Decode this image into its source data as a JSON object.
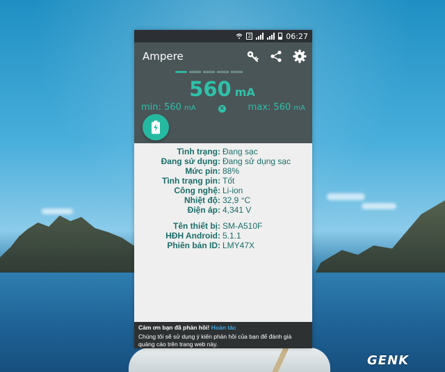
{
  "status_bar": {
    "sim_label": "2",
    "time": "06:27"
  },
  "app": {
    "title": "Ampere",
    "icons": [
      "key-icon",
      "share-icon",
      "settings-gear-icon"
    ]
  },
  "pager": {
    "count": 5,
    "active_index": 0
  },
  "current": {
    "value": "560",
    "unit": "mA"
  },
  "min": {
    "label": "min:",
    "value": "560",
    "unit": "mA"
  },
  "max": {
    "label": "max:",
    "value": "560",
    "unit": "mA"
  },
  "reset_symbol": "×",
  "info": {
    "status_label": "Tình trạng:",
    "status_value": "Đang sạc",
    "in_use_label": "Đang sử dụng:",
    "in_use_value": "Đang sử dụng sạc",
    "level_label": "Mức pin:",
    "level_value": "88%",
    "health_label": "Tình trạng pin:",
    "health_value": "Tốt",
    "tech_label": "Công nghệ:",
    "tech_value": "Li-ion",
    "temp_label": "Nhiệt độ:",
    "temp_value": "32,9 °C",
    "voltage_label": "Điện áp:",
    "voltage_value": "4,341 V",
    "device_label": "Tên thiết bị:",
    "device_value": "SM-A510F",
    "os_label": "HĐH Android:",
    "os_value": "5.1.1",
    "build_label": "Phiên bản ID:",
    "build_value": "LMY47X"
  },
  "snackbar": {
    "title": "Cảm ơn bạn đã phản hồi!",
    "action": "Hoàn tác",
    "body": "Chúng tôi sẽ sử dụng ý kiến phản hồi của bạn để đánh giá quảng cáo trên trang web này."
  },
  "watermark": "GENK",
  "colors": {
    "accent": "#2fc1aa",
    "header": "#4a5557",
    "info_text": "#1a6d69"
  }
}
